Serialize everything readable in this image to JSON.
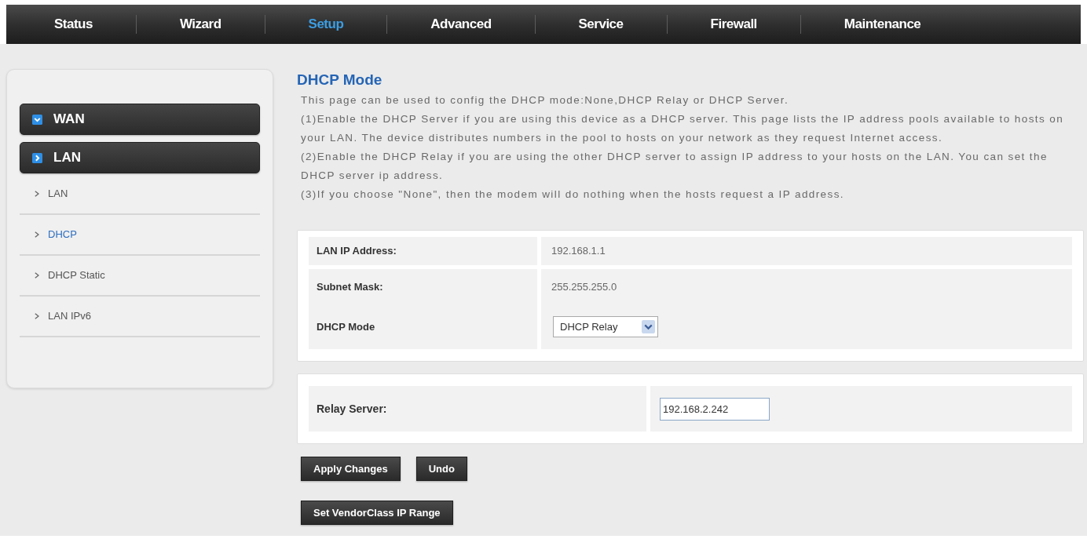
{
  "nav": {
    "tabs": [
      {
        "label": "Status",
        "selected": false
      },
      {
        "label": "Wizard",
        "selected": false
      },
      {
        "label": "Setup",
        "selected": true
      },
      {
        "label": "Advanced",
        "selected": false
      },
      {
        "label": "Service",
        "selected": false
      },
      {
        "label": "Firewall",
        "selected": false
      },
      {
        "label": "Maintenance",
        "selected": false
      }
    ]
  },
  "sidebar": {
    "groups": [
      {
        "label": "WAN",
        "expanded": true
      },
      {
        "label": "LAN",
        "expanded": false,
        "children": [
          {
            "label": "LAN",
            "selected": false
          },
          {
            "label": "DHCP",
            "selected": true
          },
          {
            "label": "DHCP Static",
            "selected": false
          },
          {
            "label": "LAN IPv6",
            "selected": false
          }
        ]
      }
    ]
  },
  "page": {
    "title": "DHCP Mode",
    "description": [
      "This page can be used to config the DHCP mode:None,DHCP Relay or DHCP Server.",
      "(1)Enable the DHCP Server if you are using this device as a DHCP server. This page lists the IP address pools available to hosts on your LAN. The device distributes numbers in the pool to hosts on your network as they request Internet access.",
      "(2)Enable the DHCP Relay if you are using the other DHCP server to assign IP address to your hosts on the LAN. You can set the DHCP server ip address.",
      "(3)If you choose \"None\", then the modem will do nothing when the hosts request a IP address."
    ]
  },
  "settings": {
    "rows": [
      {
        "kind": "text",
        "label": "LAN IP Address:",
        "value": "192.168.1.1"
      },
      {
        "kind": "text",
        "label": "Subnet Mask:",
        "value": "255.255.255.0"
      },
      {
        "kind": "select",
        "label": "DHCP Mode",
        "value": "DHCP Relay"
      }
    ]
  },
  "relay": {
    "rows": [
      {
        "kind": "input",
        "label": "Relay Server:",
        "value": "192.168.2.242"
      }
    ]
  },
  "actions": [
    [
      "Apply Changes",
      "Undo"
    ],
    [
      "Set VendorClass IP Range"
    ]
  ]
}
